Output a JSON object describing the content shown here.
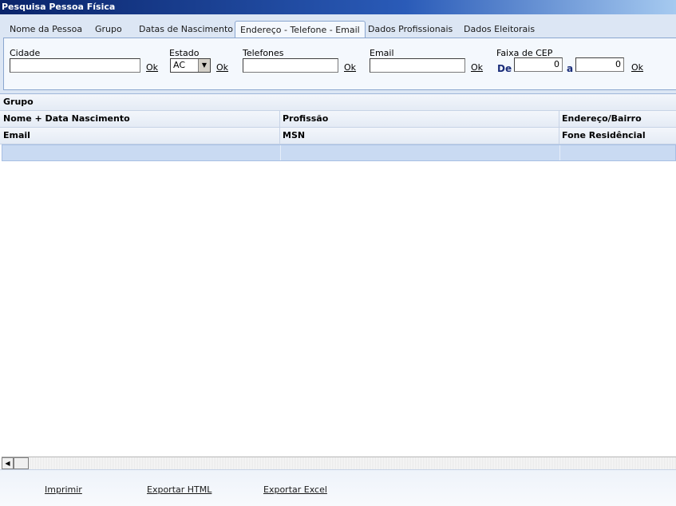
{
  "window": {
    "title": "Pesquisa Pessoa Física"
  },
  "tabs": [
    {
      "label": "Nome da Pessoa"
    },
    {
      "label": "Grupo"
    },
    {
      "label": "Datas de Nascimento"
    },
    {
      "label": "Endereço - Telefone - Email"
    },
    {
      "label": "Dados Profissionais"
    },
    {
      "label": "Dados Eleitorais"
    }
  ],
  "active_tab": "Endereço - Telefone - Email",
  "filters": {
    "cidade": {
      "label": "Cidade",
      "value": "",
      "ok": "Ok"
    },
    "estado": {
      "label": "Estado",
      "selected": "AC",
      "ok": "Ok"
    },
    "telefones": {
      "label": "Telefones",
      "value": "",
      "ok": "Ok"
    },
    "email": {
      "label": "Email",
      "value": "",
      "ok": "Ok"
    },
    "cep": {
      "label": "Faixa de CEP",
      "from_label": "De",
      "from_value": "0",
      "to_label": "a",
      "to_value": "0",
      "ok": "Ok"
    }
  },
  "grid": {
    "group_header": "Grupo",
    "header_row1": [
      "Nome + Data Nascimento",
      "Profissão",
      "Endereço/Bairro"
    ],
    "header_row2": [
      "Email",
      "MSN",
      "Fone Residêncial"
    ]
  },
  "footer": {
    "print": "Imprimir",
    "export_html": "Exportar HTML",
    "export_excel": "Exportar Excel"
  },
  "colors": {
    "title_bar": "#0a246a",
    "selected_row": "#c9daf2",
    "panel": "#f4f8fd"
  }
}
